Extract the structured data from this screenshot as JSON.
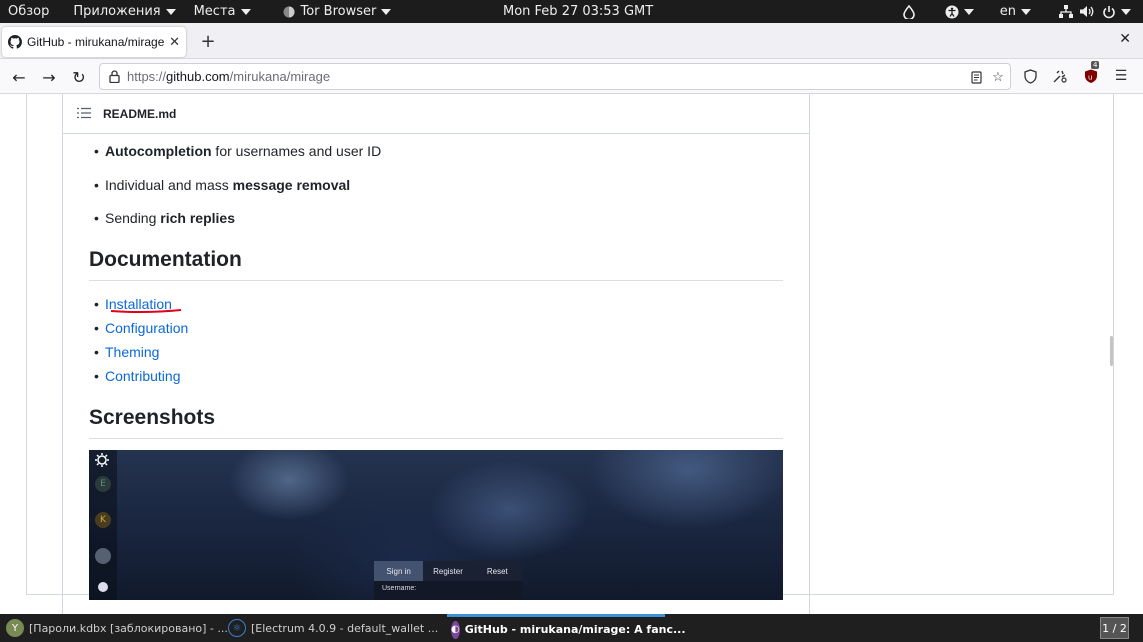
{
  "topbar": {
    "overview": "Обзор",
    "applications": "Приложения",
    "places": "Места",
    "app_name": "Tor Browser",
    "clock": "Mon Feb 27  03:53 GMT",
    "lang": "en"
  },
  "browser": {
    "tab_title": "GitHub - mirukana/mirage",
    "url_prefix": "https://",
    "url_domain": "github.com",
    "url_path": "/mirukana/mirage",
    "ublock_badge": "4"
  },
  "readme": {
    "filename": "README.md",
    "features": [
      {
        "bold": "Autocompletion",
        "before": "",
        "after": " for usernames and user ID"
      },
      {
        "bold": "message removal",
        "before": "Individual and mass ",
        "after": ""
      },
      {
        "bold": "rich replies",
        "before": "Sending ",
        "after": ""
      }
    ],
    "documentation_heading": "Documentation",
    "doc_links": [
      "Installation",
      "Configuration",
      "Theming",
      "Contributing"
    ],
    "screenshots_heading": "Screenshots",
    "screenshot_tabs": [
      "Sign in",
      "Register",
      "Reset"
    ],
    "screenshot_field": "Username:"
  },
  "taskbar": {
    "task1": "[Пароли.kdbx [заблокировано] - ...",
    "task2": "[Electrum 4.0.9  -  default_wallet  ...",
    "task3": "GitHub - mirukana/mirage: A fanc...",
    "pager": "1 / 2"
  },
  "colors": {
    "link": "#0969da",
    "annotation_underline": "#e0001b",
    "taskbar_active": "#3d8fd6"
  }
}
